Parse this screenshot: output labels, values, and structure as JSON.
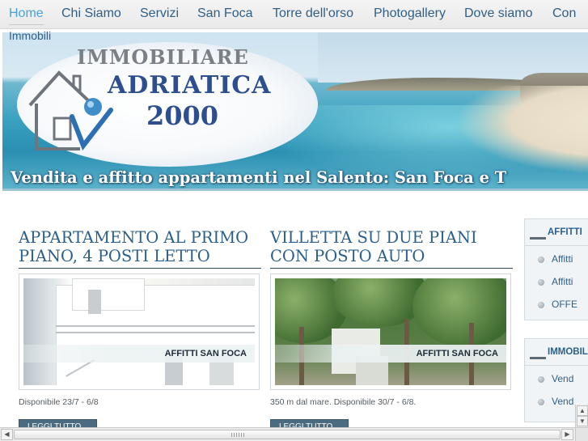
{
  "nav": {
    "items": [
      {
        "label": "Home",
        "active": true
      },
      {
        "label": "Chi Siamo"
      },
      {
        "label": "Servizi"
      },
      {
        "label": "San Foca"
      },
      {
        "label": "Torre dell'orso"
      },
      {
        "label": "Photogallery"
      },
      {
        "label": "Dove siamo"
      },
      {
        "label": "Con"
      }
    ],
    "second_row": "Immobili"
  },
  "banner": {
    "brand_line1": "IMMOBILIARE",
    "brand_line2": "ADRIATICA",
    "brand_line3": "2000",
    "caption": "Vendita e affitto appartamenti nel Salento: San Foca e T"
  },
  "listings": [
    {
      "title_line1": "APPARTAMENTO AL PRIMO",
      "title_line2": "PIANO, 4 POSTI LETTO",
      "image_label": "AFFITTI SAN FOCA",
      "description": "Disponibile 23/7 - 6/8",
      "read_more": "LEGGI TUTTO..."
    },
    {
      "title_line1": "VILLETTA SU DUE PIANI",
      "title_line2": "CON POSTO AUTO",
      "image_label": "AFFITTI SAN FOCA",
      "description": "350 m dal mare. Disponibile 30/7 - 6/8.",
      "read_more": "LEGGI TUTTO..."
    }
  ],
  "sidebar": {
    "box1": {
      "title": "AFFITTI",
      "items": [
        "Affitti",
        "Affitti",
        "OFFE"
      ]
    },
    "box2": {
      "title": "IMMOBILI",
      "items": [
        "Vend",
        "Vend"
      ]
    }
  },
  "colors": {
    "nav_text": "#2f5f86",
    "nav_active": "#4aa3d6",
    "title_blue": "#2b5f8a",
    "button_bg": "#4b6c80"
  }
}
